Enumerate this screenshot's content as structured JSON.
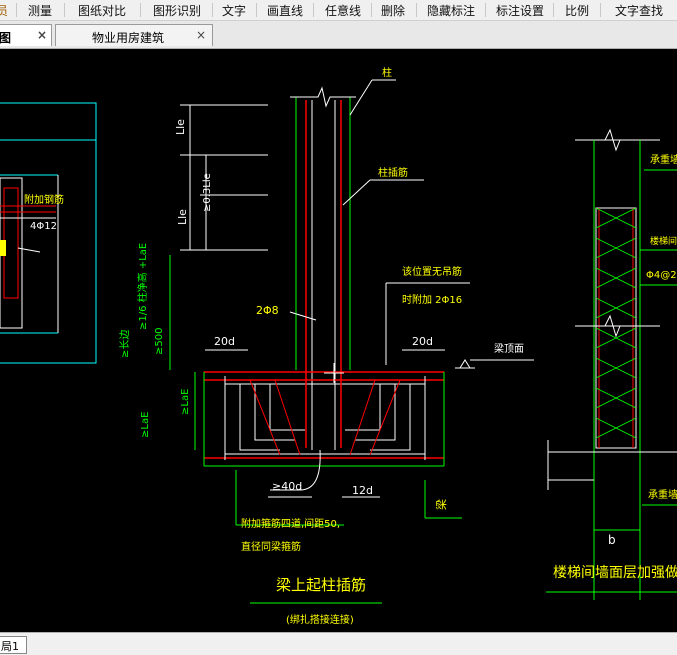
{
  "menu": {
    "clipped_first": "员",
    "items": [
      "测量",
      "图纸对比",
      "图形识别",
      "文字",
      "画直线",
      "任意线",
      "删除",
      "隐藏标注",
      "标注设置",
      "比例",
      "文字查找"
    ]
  },
  "tabs": [
    {
      "label": "图",
      "close": "×"
    },
    {
      "label": "物业用房建筑",
      "close": "×"
    }
  ],
  "status": {
    "layout_tab": "局1"
  },
  "drawing": {
    "left_panel": {
      "note": "附加钢筋",
      "rebar": "4Φ12"
    },
    "center": {
      "column_label": "柱",
      "column_insert_label": "柱插筋",
      "dim_lle_top": "Lle",
      "dim_lle_mid": "Lle",
      "dim_03lle": "≥0.3Lle",
      "dim_side_combo": "≥1/6 柱净高 +LaE",
      "dim_side_long": "≥长边",
      "dim_500": "≥500",
      "rebar_2phi8": "2Φ8",
      "note_no_hanger": "该位置无吊筋",
      "note_add_2phi16": "时附加 2Φ16",
      "dim_20d_left": "20d",
      "dim_20d_right": "20d",
      "beam_top_label": "梁顶面",
      "dim_lae_prefix": "≥LaE",
      "dim_lae_vertical": "≥LaE",
      "dim_40d": "≥40d",
      "dim_12d": "12d",
      "beam_label": "梁",
      "note_stirrup_line1": "附加箍筋四道,间距50,",
      "note_stirrup_line2": "直径同梁箍筋",
      "title": "梁上起柱插筋",
      "subtitle": "(绑扎搭接连接)"
    },
    "right": {
      "bearing_wall_top": "承重墙",
      "stair_label": "楼梯间",
      "rebar_label": "Φ4@2",
      "bearing_wall_bottom": "承重墙",
      "dim_b": "b",
      "title": "楼梯间墙面层加强做法"
    }
  },
  "colors": {
    "background": "#000000",
    "green": "#00ff00",
    "yellow": "#ffff00",
    "red": "#ff0000",
    "white": "#ffffff",
    "cyan": "#00ffff"
  }
}
